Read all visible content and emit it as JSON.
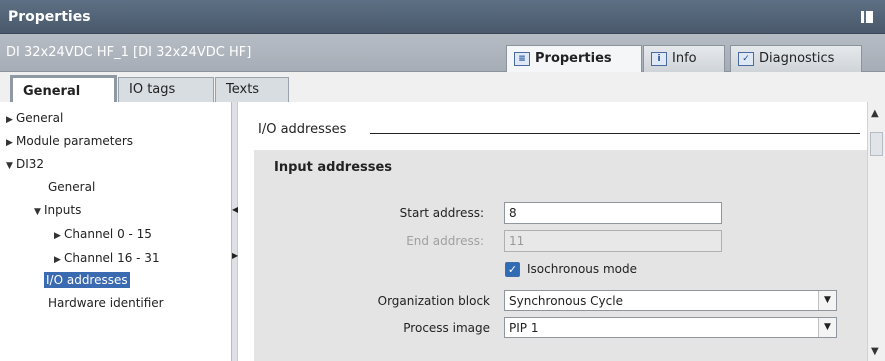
{
  "window": {
    "title": "Properties"
  },
  "subheader": {
    "device": "DI 32x24VDC HF_1 [DI 32x24VDC HF]",
    "tabs": [
      {
        "label": "Properties",
        "icon": "properties-icon"
      },
      {
        "label": "Info",
        "icon": "info-icon"
      },
      {
        "label": "Diagnostics",
        "icon": "diagnostics-icon"
      }
    ]
  },
  "tabs": [
    {
      "label": "General"
    },
    {
      "label": "IO tags"
    },
    {
      "label": "Texts"
    }
  ],
  "tree": [
    {
      "label": "General"
    },
    {
      "label": "Module parameters"
    },
    {
      "label": "DI32"
    },
    {
      "label": "General"
    },
    {
      "label": "Inputs"
    },
    {
      "label": "Channel 0 - 15"
    },
    {
      "label": "Channel 16 - 31"
    },
    {
      "label": "I/O addresses"
    },
    {
      "label": "Hardware identifier"
    }
  ],
  "main": {
    "section_title": "I/O addresses",
    "group_title": "Input addresses",
    "start_address": {
      "label": "Start address:",
      "value": "8"
    },
    "end_address": {
      "label": "End address:",
      "value": "11"
    },
    "isochronous": {
      "label": "Isochronous mode",
      "checked": true
    },
    "org_block": {
      "label": "Organization block",
      "value": "Synchronous Cycle"
    },
    "process_image": {
      "label": "Process image",
      "value": "PIP 1"
    }
  },
  "colors": {
    "title_bg": "#5d6f84",
    "selection": "#3a6ab0",
    "group_bg": "#e4e4e4"
  }
}
